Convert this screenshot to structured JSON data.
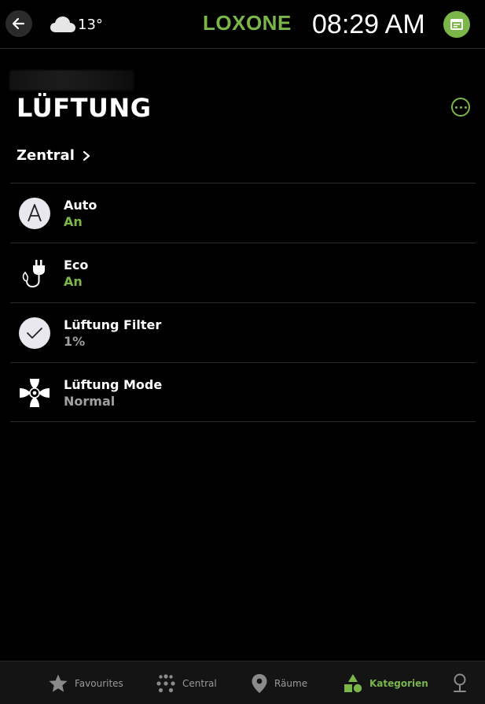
{
  "header": {
    "weather_icon": "cloud-icon",
    "temperature": "13°",
    "brand": "LOXONE",
    "time": "08:29 AM"
  },
  "page": {
    "title": "LÜFTUNG",
    "section": "Zentral"
  },
  "items": [
    {
      "title": "Auto",
      "value": "An",
      "icon": "auto-icon",
      "value_color": "#7ab648"
    },
    {
      "title": "Eco",
      "value": "An",
      "icon": "eco-plug-icon",
      "value_color": "#7ab648"
    },
    {
      "title": "Lüftung Filter",
      "value": "1%",
      "icon": "check-icon",
      "value_color": "#a0a0a0"
    },
    {
      "title": "Lüftung Mode",
      "value": "Normal",
      "icon": "fan-icon",
      "value_color": "#a0a0a0"
    }
  ],
  "nav": {
    "favourites": "Favourites",
    "central": "Central",
    "rooms": "Räume",
    "categories": "Kategorien"
  },
  "colors": {
    "accent": "#7ab648",
    "background": "#000000"
  }
}
